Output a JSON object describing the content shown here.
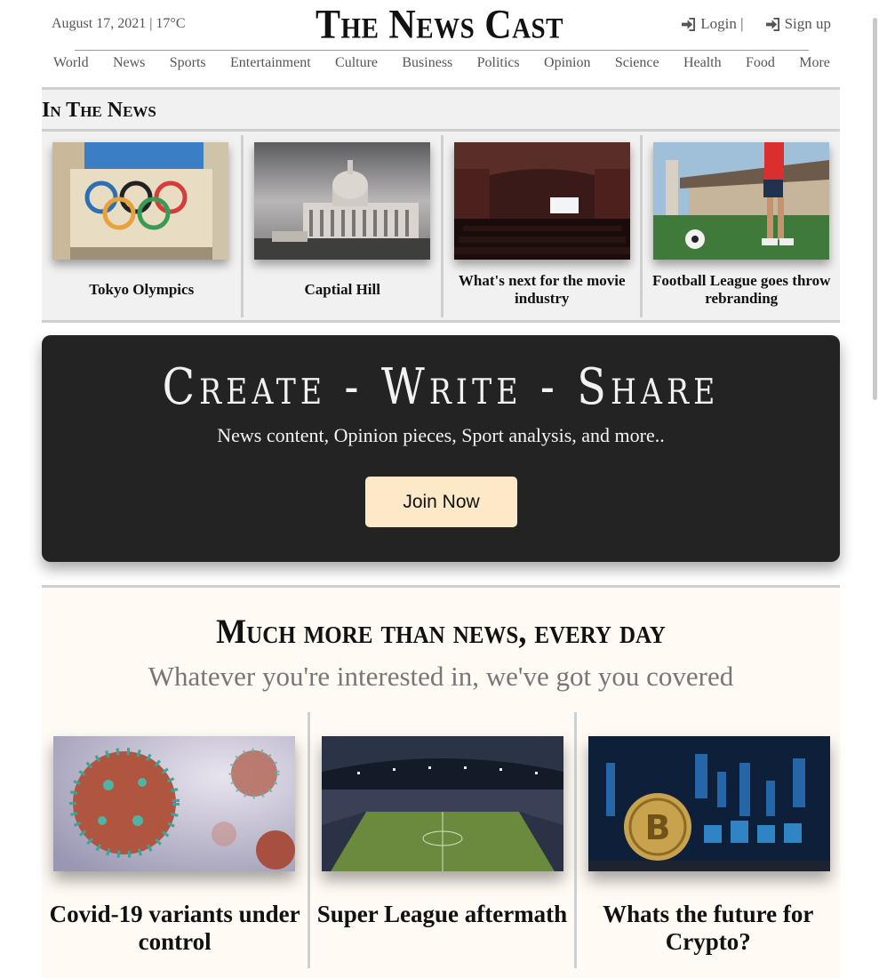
{
  "header": {
    "date": "August 17, 2021 | 17°C",
    "logo": "The News Cast",
    "login": "Login |",
    "signup": "Sign up"
  },
  "nav": [
    "World",
    "News",
    "Sports",
    "Entertainment",
    "Culture",
    "Business",
    "Politics",
    "Opinion",
    "Science",
    "Health",
    "Food",
    "More"
  ],
  "in_the_news": {
    "title": "In The News",
    "items": [
      {
        "caption": "Tokyo Olympics"
      },
      {
        "caption": "Captial Hill"
      },
      {
        "caption": "What's next for the movie industry"
      },
      {
        "caption": "Football League goes throw rebranding"
      }
    ]
  },
  "cta": {
    "title": "Create - Write - Share",
    "subtitle": "News content, Opinion pieces, Sport analysis, and more..",
    "button": "Join Now"
  },
  "more": {
    "title": "Much more than news, every day",
    "subtitle": "Whatever you're interested in, we've got you covered",
    "items": [
      {
        "caption": "Covid-19 variants under control"
      },
      {
        "caption": "Super League aftermath"
      },
      {
        "caption": "Whats the future for Crypto?"
      }
    ]
  },
  "colors": {
    "accent_button": "#fde8c7",
    "cta_background": "#232323",
    "section_background": "#fffaf4",
    "news_background": "#f1f1f1"
  },
  "icons": {
    "login": "sign-in-icon",
    "signup": "sign-in-icon"
  }
}
